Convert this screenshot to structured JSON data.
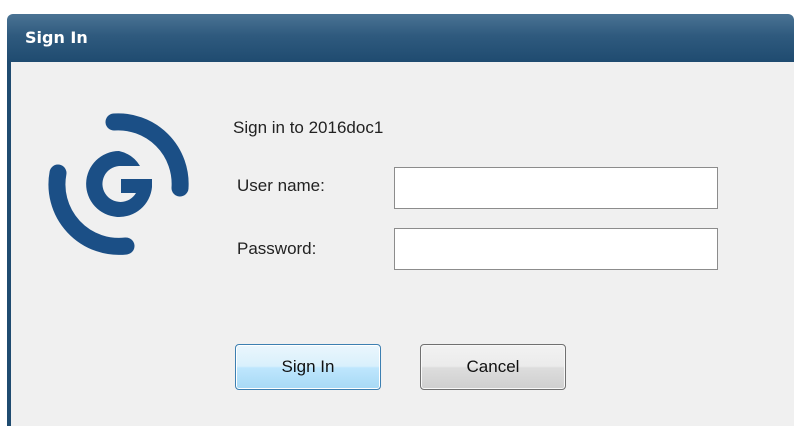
{
  "window": {
    "title": "Sign In"
  },
  "logo": {
    "icon": "brand-logo-icon",
    "color": "#1b4f86"
  },
  "form": {
    "prompt": "Sign in to 2016doc1",
    "username_label": "User name:",
    "username_value": "",
    "password_label": "Password:",
    "password_value": ""
  },
  "buttons": {
    "sign_in": "Sign In",
    "cancel": "Cancel"
  },
  "colors": {
    "title_bar": "#2f5a7e",
    "client_background": "#f0f0f0",
    "default_button_border": "#3c7fb1"
  }
}
